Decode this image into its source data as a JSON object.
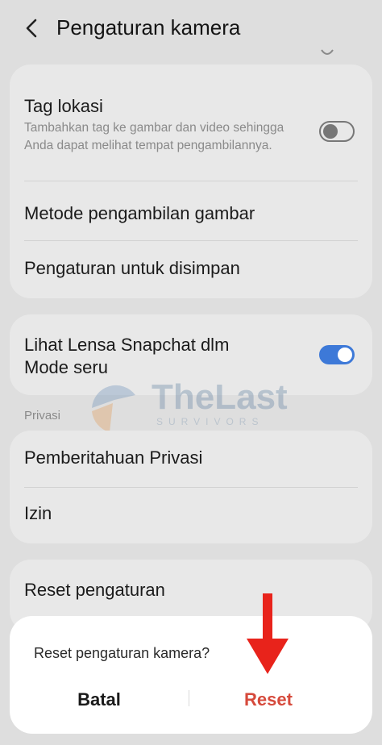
{
  "header": {
    "title": "Pengaturan kamera"
  },
  "settings": {
    "tag_location": {
      "label": "Tag lokasi",
      "description": "Tambahkan tag ke gambar dan video sehingga Anda dapat melihat tempat pengambilannya.",
      "enabled": false
    },
    "capture_method": {
      "label": "Metode pengambilan gambar"
    },
    "save_settings": {
      "label": "Pengaturan untuk disimpan"
    },
    "snapchat": {
      "label": "Lihat Lensa Snapchat dlm Mode seru",
      "enabled": true
    },
    "privacy_section": "Privasi",
    "privacy_notice": {
      "label": "Pemberitahuan Privasi"
    },
    "permissions": {
      "label": "Izin"
    },
    "reset": {
      "label": "Reset pengaturan"
    }
  },
  "watermark": {
    "name": "TheLast",
    "sub": "SURVIVORS"
  },
  "dialog": {
    "message": "Reset pengaturan kamera?",
    "cancel_label": "Batal",
    "confirm_label": "Reset"
  },
  "colors": {
    "toggle_on": "#3d79d8",
    "reset_text": "#d64a3c",
    "annotation_arrow": "#e8231b"
  }
}
